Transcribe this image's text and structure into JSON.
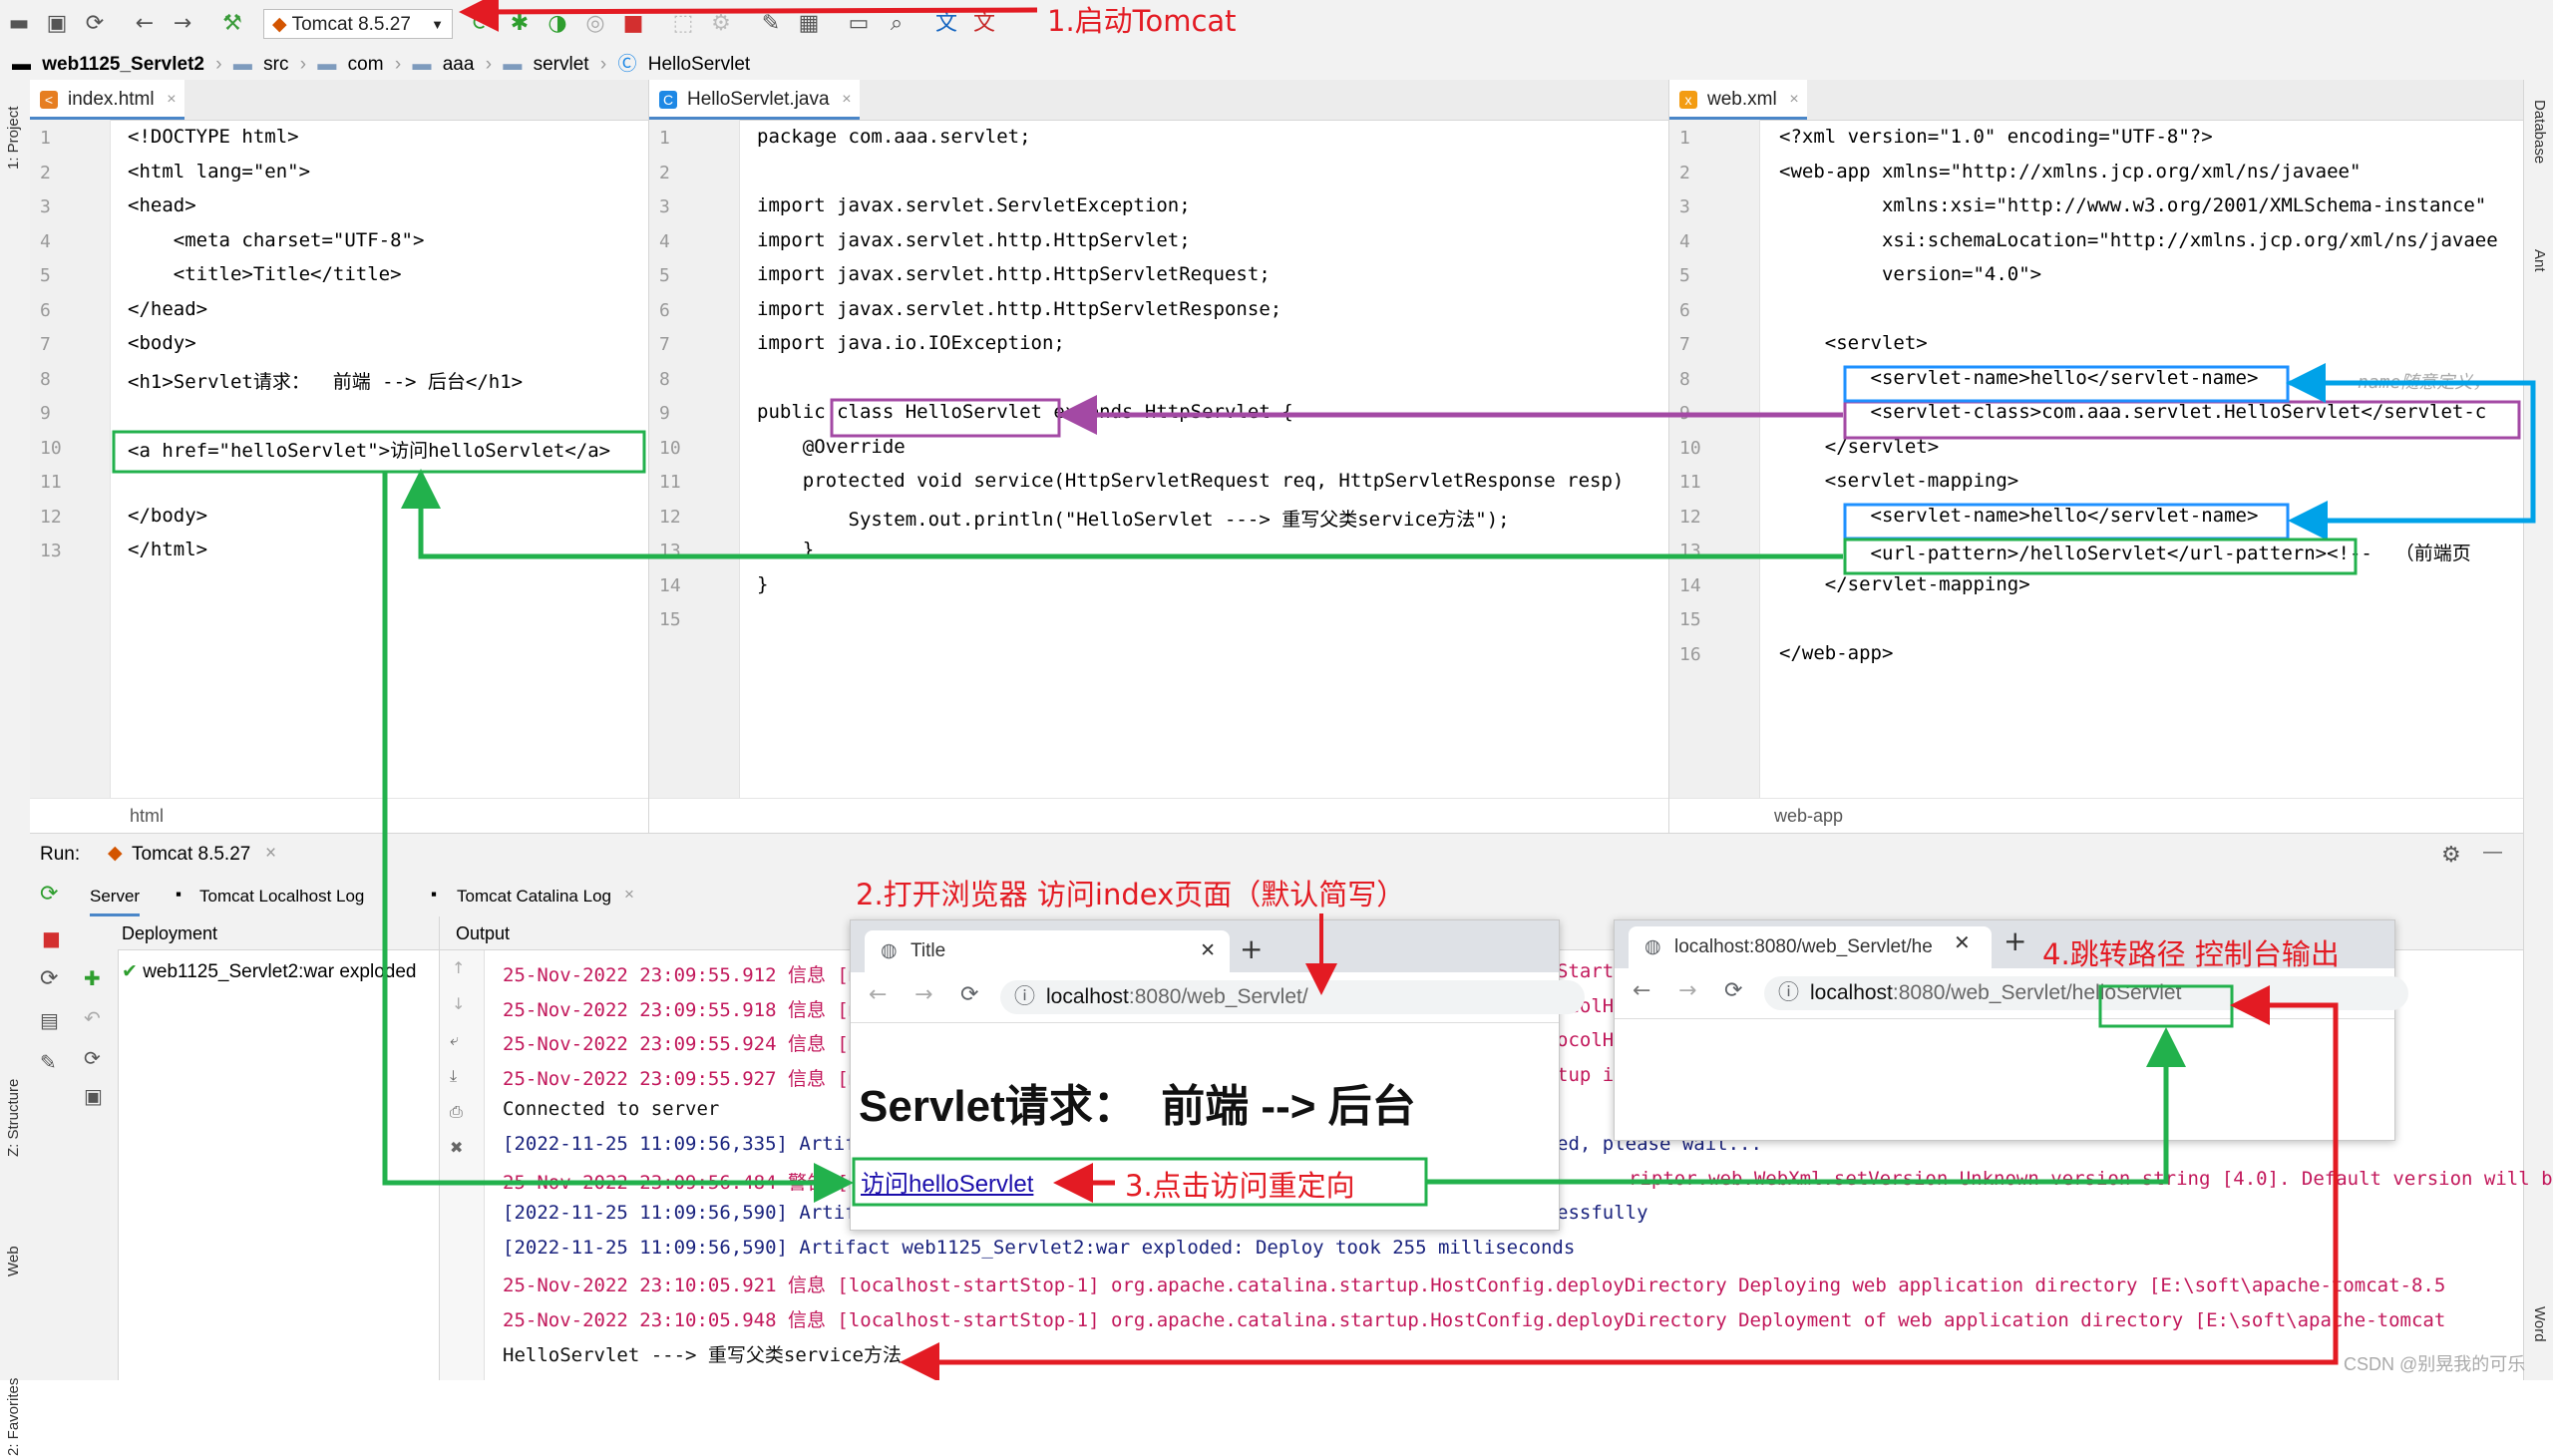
{
  "toolbar": {
    "run_config": "Tomcat 8.5.27"
  },
  "breadcrumb": [
    "web1125_Servlet2",
    "src",
    "com",
    "aaa",
    "servlet",
    "HelloServlet"
  ],
  "side_left": {
    "project": "1: Project",
    "structure": "Z: Structure",
    "web": "Web",
    "favorites": "2: Favorites"
  },
  "side_right": {
    "database": "Database",
    "ant": "Ant",
    "word": "Word"
  },
  "editor_left": {
    "tab": "index.html",
    "footer": "html",
    "line_numbers": [
      "1",
      "2",
      "3",
      "4",
      "5",
      "6",
      "7",
      "8",
      "9",
      "10",
      "11",
      "12",
      "13"
    ],
    "lines": [
      "<!DOCTYPE html>",
      "<html lang=\"en\">",
      "<head>",
      "    <meta charset=\"UTF-8\">",
      "    <title>Title</title>",
      "</head>",
      "<body>",
      "<h1>Servlet请求：  前端 --> 后台</h1>",
      "",
      "<a href=\"helloServlet\">访问helloServlet</a>",
      "",
      "</body>",
      "</html>"
    ]
  },
  "editor_mid": {
    "tab": "HelloServlet.java",
    "line_numbers": [
      "1",
      "2",
      "3",
      "4",
      "5",
      "6",
      "7",
      "8",
      "9",
      "10",
      "11",
      "12",
      "13",
      "14",
      "15"
    ],
    "lines": [
      "package com.aaa.servlet;",
      "",
      "import javax.servlet.ServletException;",
      "import javax.servlet.http.HttpServlet;",
      "import javax.servlet.http.HttpServletRequest;",
      "import javax.servlet.http.HttpServletResponse;",
      "import java.io.IOException;",
      "",
      "public class HelloServlet extends HttpServlet {",
      "    @Override",
      "    protected void service(HttpServletRequest req, HttpServletResponse resp)",
      "        System.out.println(\"HelloServlet ---> 重写父类service方法\");",
      "    }",
      "}",
      ""
    ]
  },
  "editor_right": {
    "tab": "web.xml",
    "footer": "web-app",
    "line_numbers": [
      "1",
      "2",
      "3",
      "4",
      "5",
      "6",
      "7",
      "8",
      "9",
      "10",
      "11",
      "12",
      "13",
      "14",
      "15",
      "16"
    ],
    "lines": [
      "<?xml version=\"1.0\" encoding=\"UTF-8\"?>",
      "<web-app xmlns=\"http://xmlns.jcp.org/xml/ns/javaee\"",
      "         xmlns:xsi=\"http://www.w3.org/2001/XMLSchema-instance\"",
      "         xsi:schemaLocation=\"http://xmlns.jcp.org/xml/ns/javaee",
      "         version=\"4.0\">",
      "",
      "    <servlet>",
      "        <servlet-name>hello</servlet-name>",
      "        <servlet-class>com.aaa.servlet.HelloServlet</servlet-c",
      "    </servlet>",
      "    <servlet-mapping>",
      "        <servlet-name>hello</servlet-name>",
      "        <url-pattern>/helloServlet</url-pattern><!--  （前端页",
      "    </servlet-mapping>",
      "",
      "</web-app>"
    ],
    "comment_faded": "name随意定义，"
  },
  "run": {
    "label": "Run:",
    "config": "Tomcat 8.5.27",
    "tabs": [
      "Server",
      "Tomcat Localhost Log",
      "Tomcat Catalina Log"
    ],
    "deployment_header": "Deployment",
    "output_header": "Output",
    "deployment_item": "web1125_Servlet2:war exploded"
  },
  "console": [
    {
      "text": "25-Nov-2022 23:09:55.912 信息 [m",
      "tail": "Start",
      "color": "red"
    },
    {
      "text": "25-Nov-2022 23:09:55.918 信息 [m",
      "tail": "ocolH",
      "color": "red"
    },
    {
      "text": "25-Nov-2022 23:09:55.924 信息 [m",
      "tail": "ocolH",
      "color": "red"
    },
    {
      "text": "25-Nov-2022 23:09:55.927 信息 [m",
      "tail": "tup i",
      "color": "red"
    },
    {
      "text": "Connected to server",
      "tail": "",
      "color": "black"
    },
    {
      "text": "[2022-11-25 11:09:56,335] Artifa",
      "tail": "ed, please wait...",
      "color": "blue"
    },
    {
      "text": "25-Nov-2022 23:09:56.484 警告 [m",
      "tail": "riptor.web.WebXml.setVersion Unknown version string [4.0]. Default version will b",
      "color": "red"
    },
    {
      "text": "[2022-11-25 11:09:56,590] Artifa",
      "tail": "essfully",
      "color": "blue"
    },
    {
      "text": "[2022-11-25 11:09:56,590] Artifact web1125_Servlet2:war exploded: Deploy took 255 milliseconds",
      "tail": "",
      "color": "blue"
    },
    {
      "text": "25-Nov-2022 23:10:05.921 信息 [localhost-startStop-1] org.apache.catalina.startup.HostConfig.deployDirectory Deploying web application directory [E:\\soft\\apache-tomcat-8.5",
      "tail": "",
      "color": "red"
    },
    {
      "text": "25-Nov-2022 23:10:05.948 信息 [localhost-startStop-1] org.apache.catalina.startup.HostConfig.deployDirectory Deployment of web application directory [E:\\soft\\apache-tomcat",
      "tail": "",
      "color": "red"
    },
    {
      "text": "HelloServlet ---> 重写父类service方法",
      "tail": "",
      "color": "black"
    }
  ],
  "browser1": {
    "tab_title": "Title",
    "url_host": "localhost",
    "url_rest": ":8080/web_Servlet/",
    "heading": "Servlet请求：  前端 --> 后台",
    "link": "访问helloServlet"
  },
  "browser2": {
    "tab_title": "localhost:8080/web_Servlet/he",
    "url_host": "localhost",
    "url_rest": ":8080/web_Servlet",
    "url_path": "/helloServlet"
  },
  "annotations": {
    "step1": "1.启动Tomcat",
    "step2": "2.打开浏览器 访问index页面（默认简写）",
    "step3": "3.点击访问重定向",
    "step4": "4.跳转路径 控制台输出"
  },
  "watermark": "CSDN @别晃我的可乐",
  "colors": {
    "annotation_red": "#e31b23",
    "arrow_green": "#22b14c",
    "arrow_purple": "#a349a4",
    "arrow_blue": "#00a2e8",
    "box_blue": "#1e90ff"
  }
}
